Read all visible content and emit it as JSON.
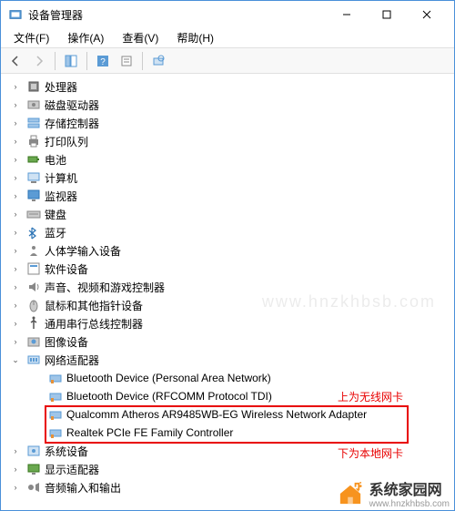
{
  "window": {
    "title": "设备管理器"
  },
  "menu": {
    "file": "文件(F)",
    "action": "操作(A)",
    "view": "查看(V)",
    "help": "帮助(H)"
  },
  "tree": {
    "items": [
      {
        "icon": "cpu",
        "label": "处理器"
      },
      {
        "icon": "disk",
        "label": "磁盘驱动器"
      },
      {
        "icon": "storage",
        "label": "存储控制器"
      },
      {
        "icon": "printer",
        "label": "打印队列"
      },
      {
        "icon": "battery",
        "label": "电池"
      },
      {
        "icon": "computer",
        "label": "计算机"
      },
      {
        "icon": "monitor",
        "label": "监视器"
      },
      {
        "icon": "keyboard",
        "label": "键盘"
      },
      {
        "icon": "bluetooth",
        "label": "蓝牙"
      },
      {
        "icon": "hid",
        "label": "人体学输入设备"
      },
      {
        "icon": "software",
        "label": "软件设备"
      },
      {
        "icon": "audio",
        "label": "声音、视频和游戏控制器"
      },
      {
        "icon": "mouse",
        "label": "鼠标和其他指针设备"
      },
      {
        "icon": "usb",
        "label": "通用串行总线控制器"
      },
      {
        "icon": "imaging",
        "label": "图像设备"
      },
      {
        "icon": "network",
        "label": "网络适配器",
        "expanded": true,
        "children": [
          {
            "icon": "net-card",
            "label": "Bluetooth Device (Personal Area Network)"
          },
          {
            "icon": "net-card",
            "label": "Bluetooth Device (RFCOMM Protocol TDI)"
          },
          {
            "icon": "net-card",
            "label": "Qualcomm Atheros AR9485WB-EG Wireless Network Adapter"
          },
          {
            "icon": "net-card",
            "label": "Realtek PCIe FE Family Controller"
          }
        ]
      },
      {
        "icon": "system",
        "label": "系统设备"
      },
      {
        "icon": "display",
        "label": "显示适配器"
      },
      {
        "icon": "audio-io",
        "label": "音频输入和输出"
      }
    ]
  },
  "annotations": {
    "top": "上为无线网卡",
    "bottom": "下为本地网卡"
  },
  "watermark": "www.hnzkhbsb.com",
  "footer": {
    "name": "系统家园网",
    "url": "www.hnzkhbsb.com"
  }
}
